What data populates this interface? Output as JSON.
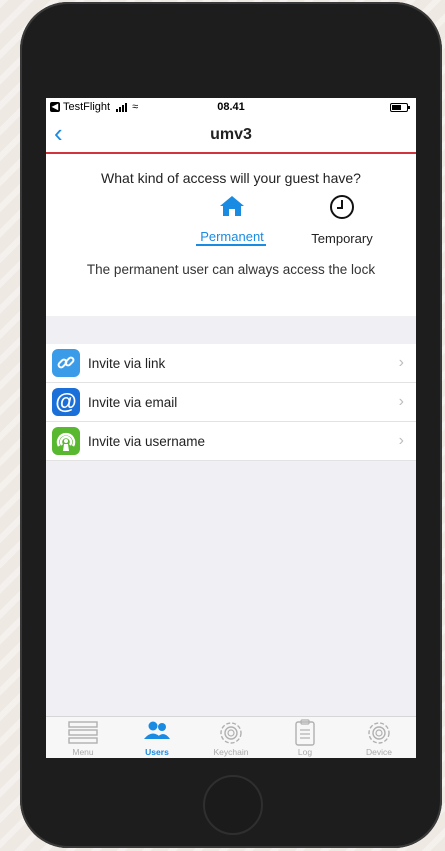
{
  "status_bar": {
    "back_app": "TestFlight",
    "time": "08.41"
  },
  "nav": {
    "back_icon": "chevron-left-icon",
    "title": "umv3"
  },
  "access": {
    "question": "What kind of access will your guest have?",
    "options": [
      {
        "label": "Permanent",
        "icon": "house-icon",
        "selected": true
      },
      {
        "label": "Temporary",
        "icon": "clock-icon",
        "selected": false
      }
    ],
    "description": "The permanent user can always access the lock"
  },
  "invite": {
    "items": [
      {
        "label": "Invite via link",
        "icon": "link-icon",
        "color": "#3a9be8"
      },
      {
        "label": "Invite via email",
        "icon": "at-icon",
        "color": "#1a6fd8"
      },
      {
        "label": "Invite via username",
        "icon": "user-signal-icon",
        "color": "#58b82f"
      }
    ]
  },
  "tabbar": {
    "tabs": [
      {
        "label": "Menu",
        "icon": "menu-icon",
        "active": false
      },
      {
        "label": "Users",
        "icon": "users-icon",
        "active": true
      },
      {
        "label": "Keychain",
        "icon": "gear-icon",
        "active": false
      },
      {
        "label": "Log",
        "icon": "clipboard-icon",
        "active": false
      },
      {
        "label": "Device",
        "icon": "gear-icon",
        "active": false
      }
    ]
  },
  "colors": {
    "accent": "#1a8be2",
    "nav_underline": "#d0343d"
  }
}
